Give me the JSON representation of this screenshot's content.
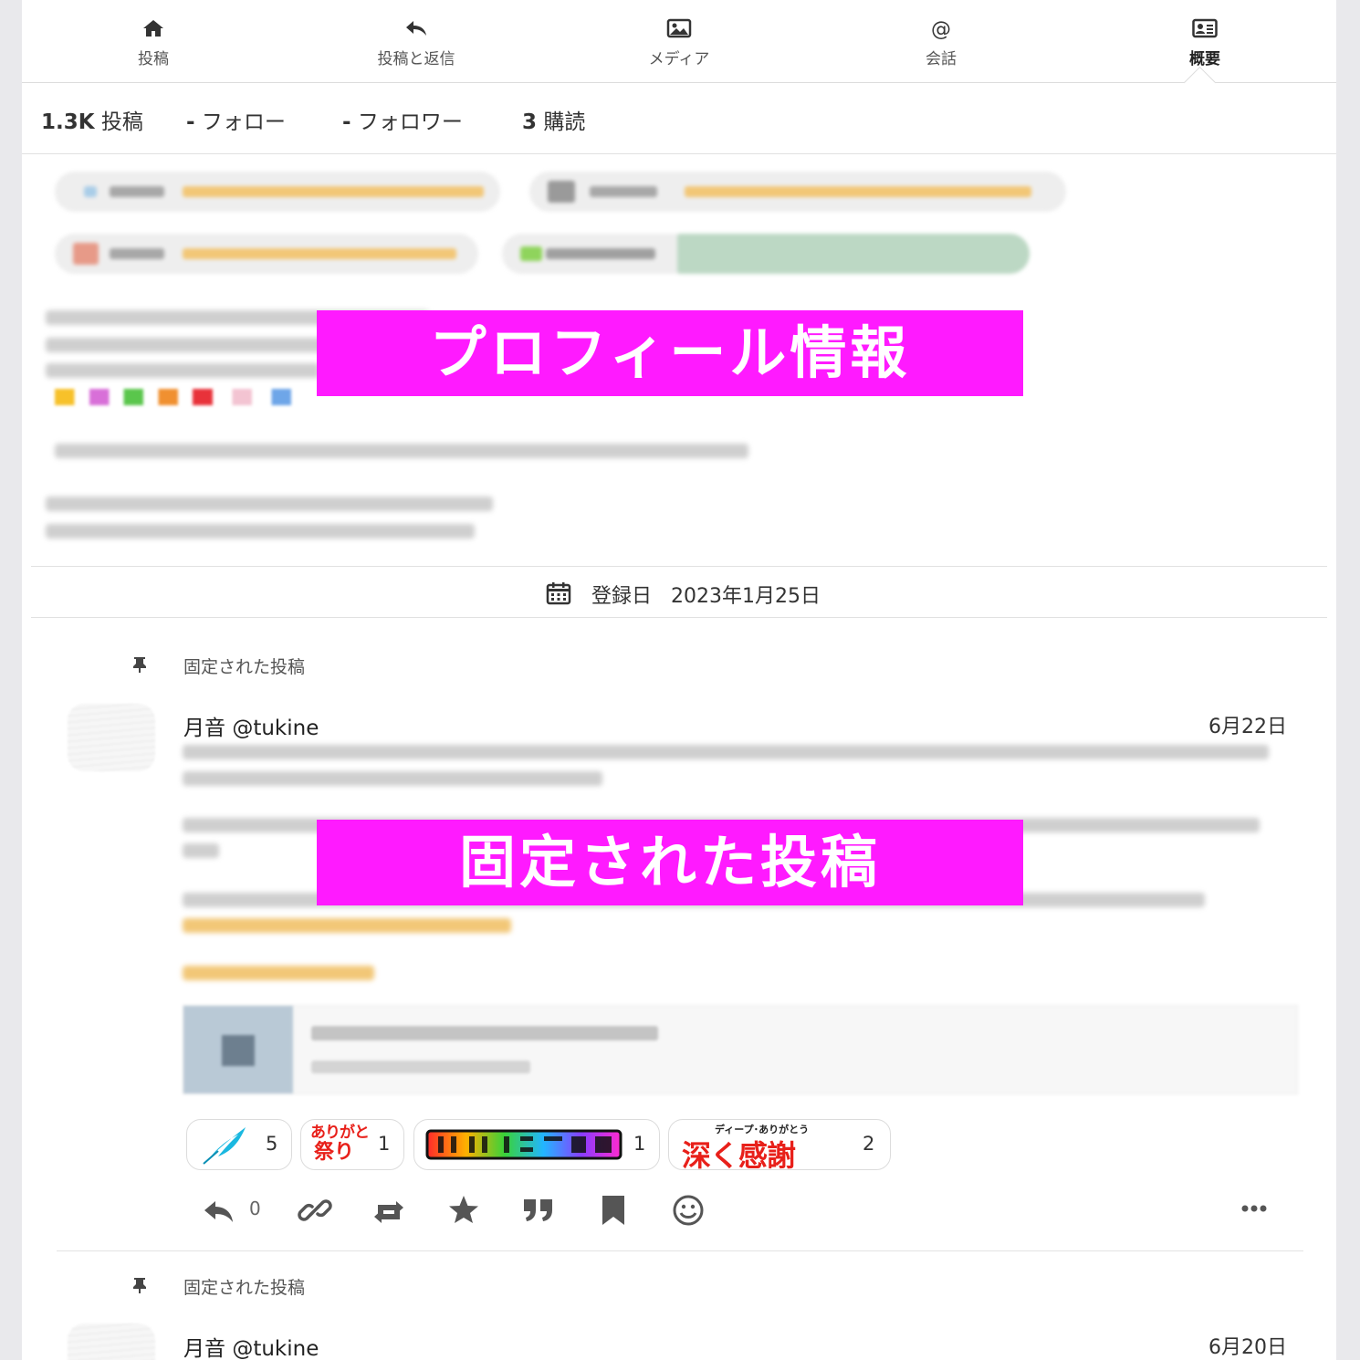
{
  "tabs": [
    {
      "label": "投稿",
      "icon": "home-icon"
    },
    {
      "label": "投稿と返信",
      "icon": "reply-icon"
    },
    {
      "label": "メディア",
      "icon": "image-icon"
    },
    {
      "label": "会話",
      "icon": "at-sign-icon"
    },
    {
      "label": "概要",
      "icon": "profile-card-icon",
      "active": true
    }
  ],
  "counts": {
    "posts_value": "1.3K",
    "posts_label": "投稿",
    "following_value": "-",
    "following_label": "フォロー",
    "followers_value": "-",
    "followers_label": "フォロワー",
    "subs_value": "3",
    "subs_label": "購読"
  },
  "overlays": {
    "profile": "プロフィール情報",
    "pinned": "固定された投稿"
  },
  "joined": {
    "label": "登録日",
    "date": "2023年1月25日"
  },
  "pinned_label": "固定された投稿",
  "posts": [
    {
      "author_name": "月音",
      "handle": "@tukine",
      "date": "6月22日",
      "reply_count": "0",
      "reactions": [
        {
          "name": "feather-emoji",
          "count": "5"
        },
        {
          "name": "arigato-matsuri-emoji",
          "count": "1",
          "text_top": "ありがと",
          "text_bottom": "祭り"
        },
        {
          "name": "ultra-kansha-emoji",
          "count": "1"
        },
        {
          "name": "deep-thanks-emoji",
          "count": "2",
          "ruby": "ディープ･ありがとう",
          "text": "深く感謝"
        }
      ]
    },
    {
      "author_name": "月音",
      "handle": "@tukine",
      "date": "6月20日"
    }
  ],
  "colors": {
    "highlight": "#ff1aff",
    "reaction_text_red": "#e8201a",
    "feather": "#1ab8e0"
  }
}
